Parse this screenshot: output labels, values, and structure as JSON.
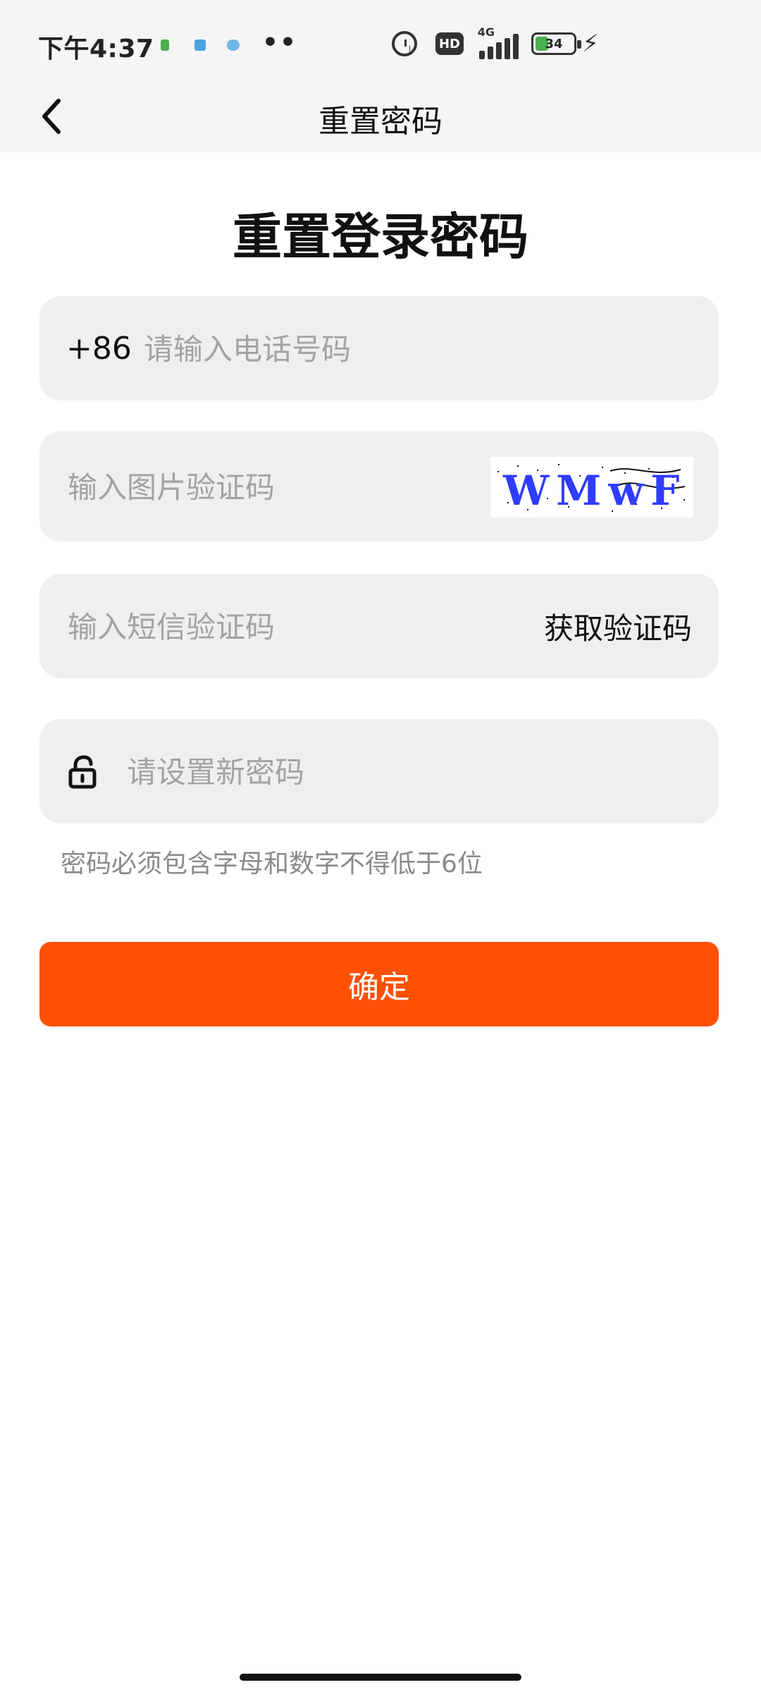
{
  "status_bar": {
    "time": "下午4:37",
    "dots": "••",
    "hd": "HD",
    "network": "4G",
    "battery": "34",
    "charging_icon": "⚡",
    "icons": [
      "notification-icon",
      "notification-icon",
      "notification-icon",
      "alarm-icon",
      "hd-icon",
      "signal-icon",
      "battery-icon",
      "charging-icon"
    ]
  },
  "nav": {
    "title": "重置密码",
    "back_icon": "chevron-left-icon"
  },
  "page": {
    "title": "重置登录密码",
    "phone": {
      "prefix": "+86",
      "placeholder": "请输入电话号码",
      "value": ""
    },
    "captcha_image": {
      "placeholder": "输入图片验证码",
      "value": "",
      "text": "WMwF"
    },
    "sms": {
      "placeholder": "输入短信验证码",
      "value": "",
      "action": "获取验证码"
    },
    "new_password": {
      "placeholder": "请设置新密码",
      "value": "",
      "icon": "unlock-icon"
    },
    "hint": "密码必须包含字母和数字不得低于6位",
    "confirm_label": "确定",
    "colors": {
      "accent": "#ff5005",
      "field_bg": "#efefef",
      "header_bg": "#f5f5f5",
      "captcha_text": "#2f3cff"
    }
  }
}
